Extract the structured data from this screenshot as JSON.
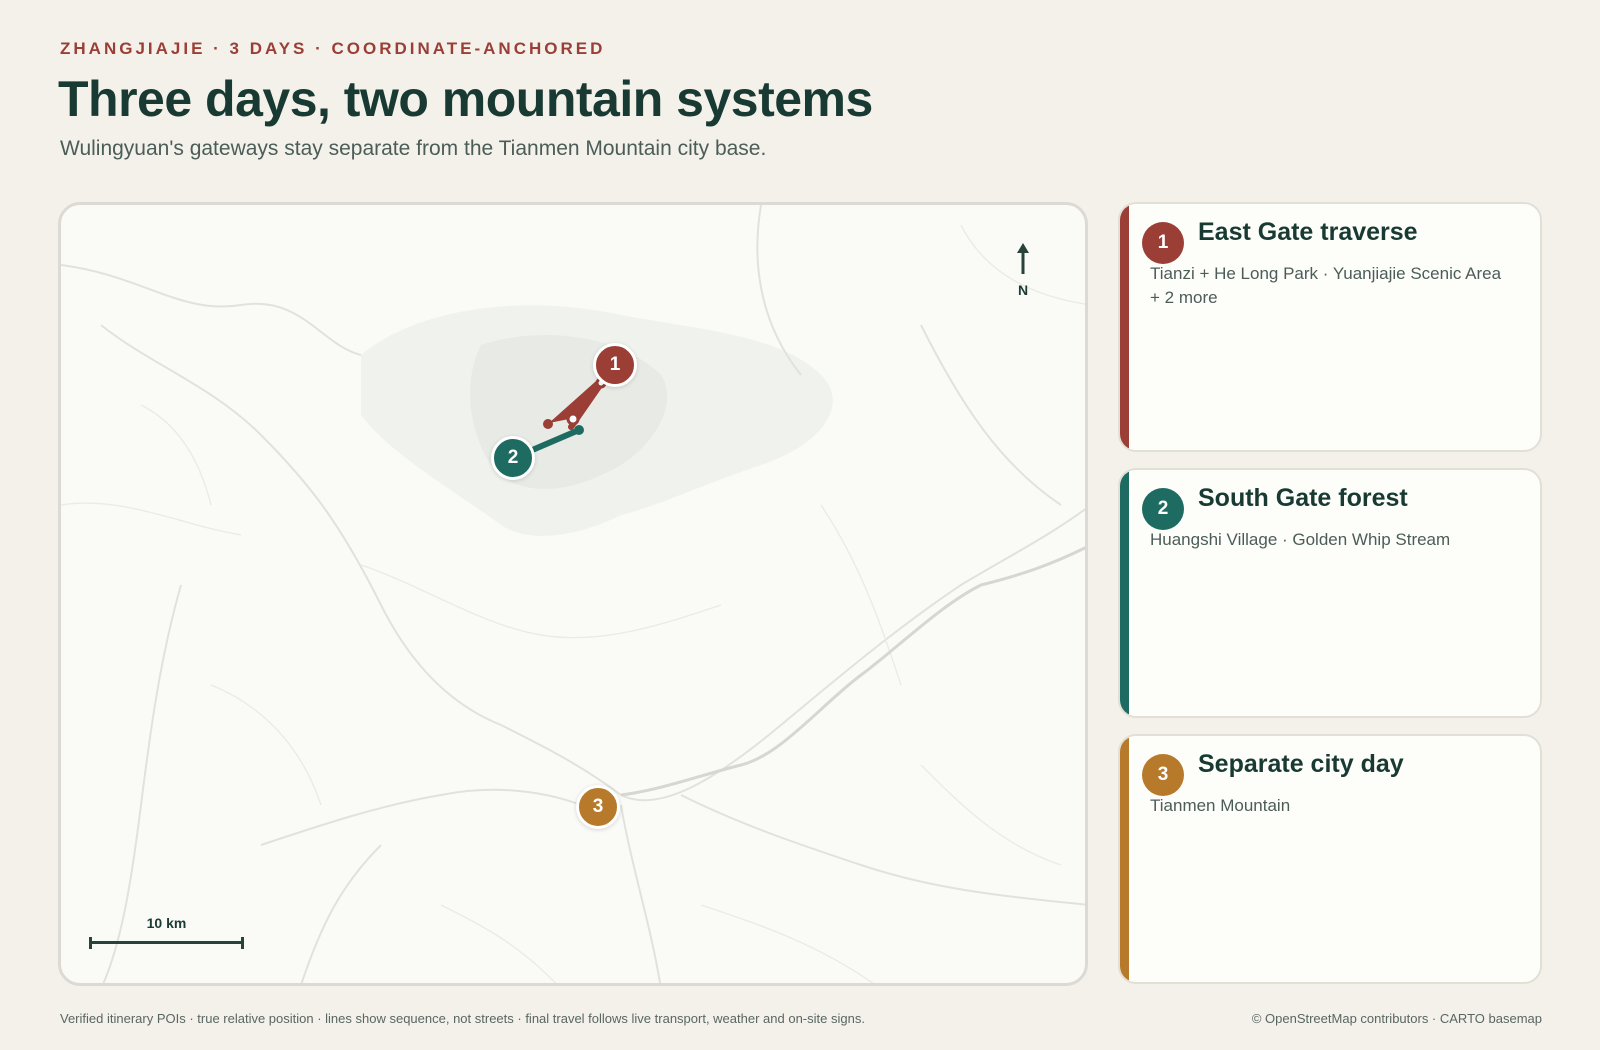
{
  "header": {
    "eyebrow": "ZHANGJIAJIE · 3 DAYS · COORDINATE-ANCHORED",
    "title": "Three days, two mountain systems",
    "subtitle": "Wulingyuan's gateways stay separate from the Tianmen Mountain city base."
  },
  "map": {
    "north_label": "N",
    "scale_label": "10 km",
    "markers": [
      {
        "number": "1",
        "color": "#9a3e36"
      },
      {
        "number": "2",
        "color": "#1e6b62"
      },
      {
        "number": "3",
        "color": "#b7792a"
      }
    ]
  },
  "days": [
    {
      "number": "1",
      "title": "East Gate traverse",
      "description": "Tianzi + He Long Park · Yuanjiajie Scenic Area + 2 more",
      "color": "#9a3e36"
    },
    {
      "number": "2",
      "title": "South Gate forest",
      "description": "Huangshi Village · Golden Whip Stream",
      "color": "#1e6b62"
    },
    {
      "number": "3",
      "title": "Separate city day",
      "description": "Tianmen Mountain",
      "color": "#b7792a"
    }
  ],
  "footer": {
    "note": "Verified itinerary POIs · true relative position · lines show sequence, not streets · final travel follows live transport, weather and on-site signs.",
    "credit": "© OpenStreetMap contributors · CARTO basemap"
  },
  "icons": {
    "north_arrow": "arrow-up-icon"
  }
}
